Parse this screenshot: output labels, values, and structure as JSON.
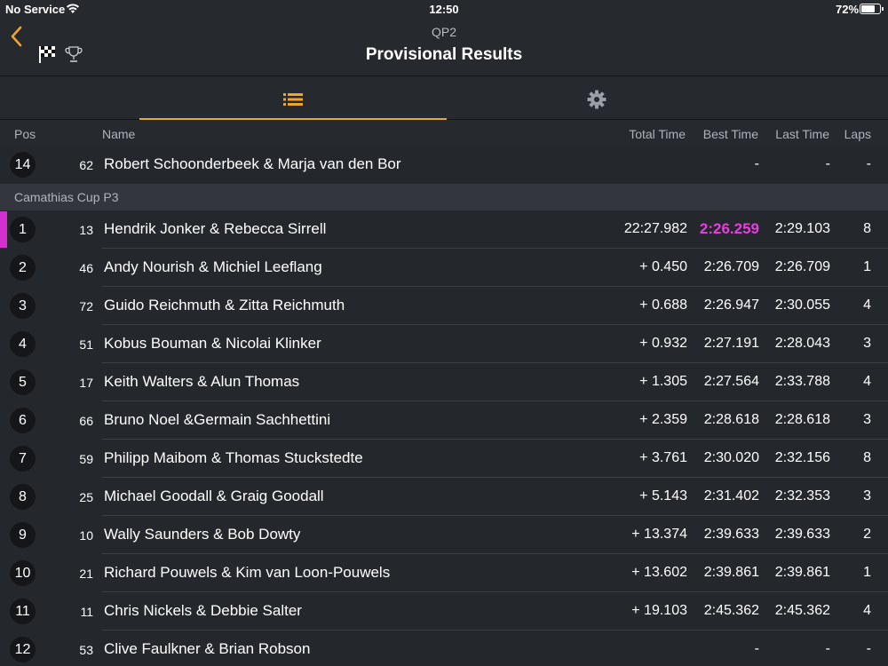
{
  "status_bar": {
    "carrier": "No Service",
    "time": "12:50",
    "battery": "72%"
  },
  "nav": {
    "subtitle": "QP2",
    "title": "Provisional Results"
  },
  "icons": {
    "back": "chevron-left-icon",
    "flag": "checkered-flag-icon",
    "trophy": "trophy-icon",
    "list": "list-icon",
    "settings": "gear-icon"
  },
  "colors": {
    "accent": "#f0a430",
    "fastest": "#e83ede"
  },
  "table": {
    "headers": {
      "pos": "Pos",
      "name": "Name",
      "total": "Total Time",
      "best": "Best Time",
      "last": "Last Time",
      "laps": "Laps"
    }
  },
  "top_rows": [
    {
      "pos": "14",
      "num": "62",
      "name": "Robert Schoonderbeek & Marja van den Bor",
      "total": "",
      "best": "-",
      "last": "-",
      "laps": "-"
    }
  ],
  "group": {
    "name": "Camathias Cup P3",
    "rows": [
      {
        "pos": "1",
        "num": "13",
        "name": "Hendrik Jonker & Rebecca Sirrell",
        "total": "22:27.982",
        "best": "2:26.259",
        "last": "2:29.103",
        "laps": "8"
      },
      {
        "pos": "2",
        "num": "46",
        "name": "Andy Nourish & Michiel Leeflang",
        "total": "+ 0.450",
        "best": "2:26.709",
        "last": "2:26.709",
        "laps": "1"
      },
      {
        "pos": "3",
        "num": "72",
        "name": "Guido Reichmuth & Zitta Reichmuth",
        "total": "+ 0.688",
        "best": "2:26.947",
        "last": "2:30.055",
        "laps": "4"
      },
      {
        "pos": "4",
        "num": "51",
        "name": "Kobus Bouman & Nicolai Klinker",
        "total": "+ 0.932",
        "best": "2:27.191",
        "last": "2:28.043",
        "laps": "3"
      },
      {
        "pos": "5",
        "num": "17",
        "name": "Keith Walters & Alun Thomas",
        "total": "+ 1.305",
        "best": "2:27.564",
        "last": "2:33.788",
        "laps": "4"
      },
      {
        "pos": "6",
        "num": "66",
        "name": "Bruno Noel &Germain Sachhettini",
        "total": "+ 2.359",
        "best": "2:28.618",
        "last": "2:28.618",
        "laps": "3"
      },
      {
        "pos": "7",
        "num": "59",
        "name": "Philipp Maibom & Thomas Stuckstedte",
        "total": "+ 3.761",
        "best": "2:30.020",
        "last": "2:32.156",
        "laps": "8"
      },
      {
        "pos": "8",
        "num": "25",
        "name": "Michael Goodall & Graig Goodall",
        "total": "+ 5.143",
        "best": "2:31.402",
        "last": "2:32.353",
        "laps": "3"
      },
      {
        "pos": "9",
        "num": "10",
        "name": "Wally Saunders & Bob Dowty",
        "total": "+ 13.374",
        "best": "2:39.633",
        "last": "2:39.633",
        "laps": "2"
      },
      {
        "pos": "10",
        "num": "21",
        "name": "Richard Pouwels & Kim van Loon-Pouwels",
        "total": "+ 13.602",
        "best": "2:39.861",
        "last": "2:39.861",
        "laps": "1"
      },
      {
        "pos": "11",
        "num": "11",
        "name": "Chris Nickels & Debbie Salter",
        "total": "+ 19.103",
        "best": "2:45.362",
        "last": "2:45.362",
        "laps": "4"
      },
      {
        "pos": "12",
        "num": "53",
        "name": "Clive Faulkner & Brian Robson",
        "total": "",
        "best": "-",
        "last": "-",
        "laps": "-"
      }
    ]
  }
}
